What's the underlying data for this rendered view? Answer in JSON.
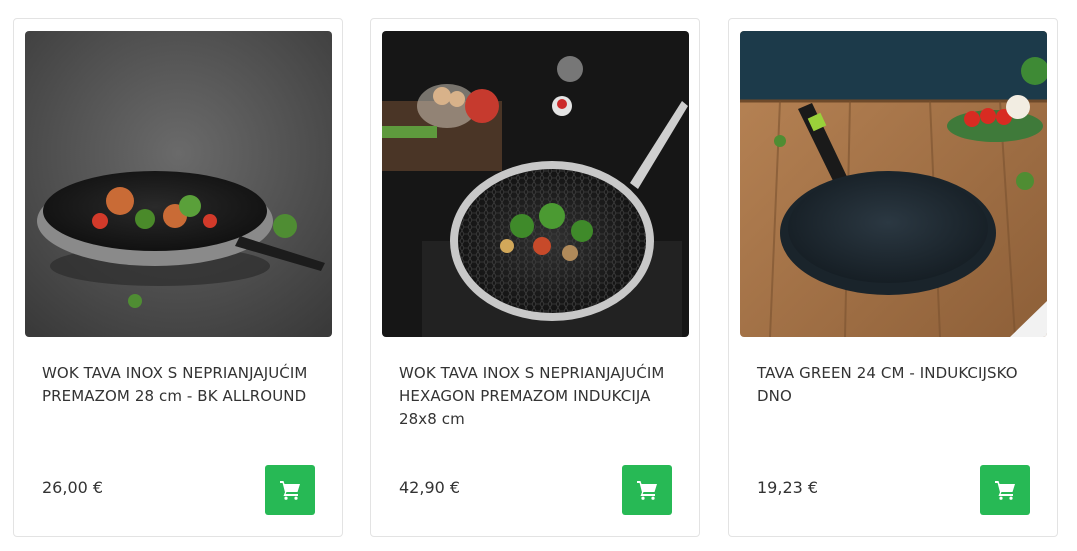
{
  "products": [
    {
      "title": "WOK TAVA INOX S NEPRIANJAJUĆIM PREMAZOM 28 cm - BK ALLROUND",
      "price": "26,00 €",
      "image": "wok-pan-stir-fry-photo",
      "cart_icon": "shopping-cart-icon"
    },
    {
      "title": "WOK TAVA INOX S NEPRIANJAJUĆIM HEXAGON PREMAZOM INDUKCIJA 28x8 cm",
      "price": "42,90 €",
      "image": "hexagon-wok-vegetables-photo",
      "cart_icon": "shopping-cart-icon"
    },
    {
      "title": "TAVA GREEN 24 CM - INDUKCIJSKO DNO",
      "price": "19,23 €",
      "image": "green-frying-pan-table-photo",
      "cart_icon": "shopping-cart-icon"
    }
  ],
  "colors": {
    "cart_button": "#27b955",
    "card_border": "#e3e3e3",
    "text": "#333333"
  }
}
